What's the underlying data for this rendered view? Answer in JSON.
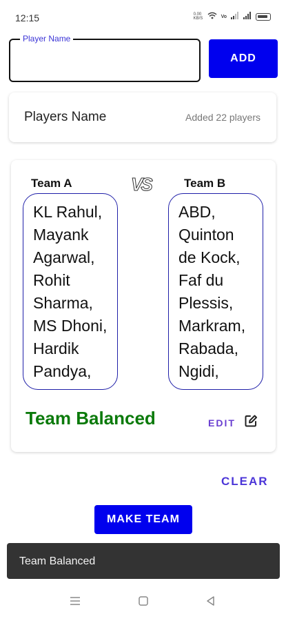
{
  "status_bar": {
    "time": "12:15",
    "network_speed": "0.00 KB/S"
  },
  "player_input": {
    "label": "Player Name",
    "value": "",
    "placeholder": ""
  },
  "add_button": {
    "label": "ADD"
  },
  "players_card": {
    "title": "Players Name",
    "count_text": "Added 22 players"
  },
  "teams": {
    "team_a": {
      "header": "Team A",
      "players": [
        "KL Rahul,",
        "Mayank",
        "Agarwal,",
        "Rohit",
        "Sharma,",
        "MS Dhoni,",
        "Hardik",
        "Pandya,"
      ]
    },
    "vs_label": "VS",
    "team_b": {
      "header": "Team B",
      "players": [
        "ABD,",
        "Quinton",
        "de Kock,",
        "Faf du",
        "Plessis,",
        "Markram,",
        "Rabada,",
        "Ngidi,"
      ]
    },
    "status": "Team Balanced",
    "edit_label": "EDIT"
  },
  "clear_button": {
    "label": "CLEAR"
  },
  "make_team_button": {
    "label": "MAKE TEAM"
  },
  "snackbar": {
    "message": "Team Balanced"
  },
  "colors": {
    "primary_button": "#0000ee",
    "balanced_text": "#0b7a0b",
    "team_box_border": "#1e1ea8",
    "accent_text": "#4b35d8",
    "snackbar_bg": "#333333"
  },
  "icons": {
    "edit": "edit-pencil-square-icon",
    "nav_menu": "menu-lines-icon",
    "nav_home": "square-home-icon",
    "nav_back": "triangle-back-icon"
  }
}
